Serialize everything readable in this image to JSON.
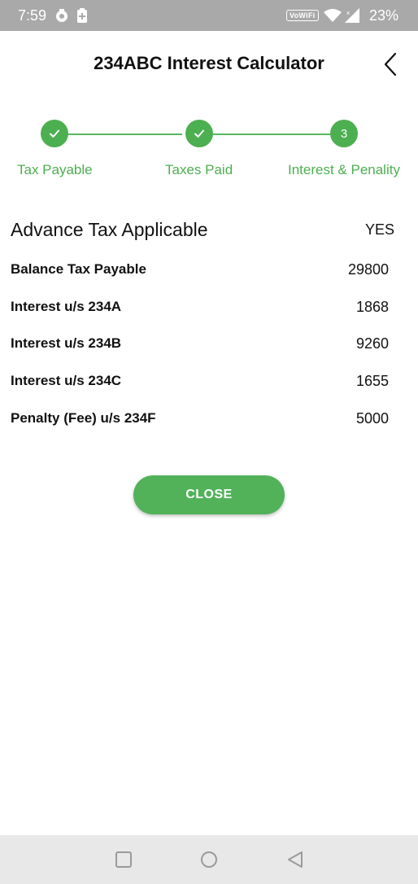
{
  "status_bar": {
    "time": "7:59",
    "vowifi": "VoWiFi",
    "battery": "23%",
    "icons": [
      "settings-icon",
      "battery-saver-icon",
      "wifi-icon",
      "signal-icon"
    ]
  },
  "header": {
    "title": "234ABC Interest Calculator",
    "back_icon": "chevron-left-icon"
  },
  "stepper": {
    "steps": [
      {
        "label": "Tax Payable",
        "state": "done",
        "marker": "check-icon"
      },
      {
        "label": "Taxes Paid",
        "state": "done",
        "marker": "check-icon"
      },
      {
        "label": "Interest & Penality",
        "state": "current",
        "number": "3"
      }
    ],
    "accent_color": "#4caf50"
  },
  "results": {
    "advance_tax": {
      "label": "Advance Tax Applicable",
      "value": "YES"
    },
    "rows": [
      {
        "label": "Balance Tax Payable",
        "value": "29800"
      },
      {
        "label": "Interest u/s 234A",
        "value": "1868"
      },
      {
        "label": "Interest u/s 234B",
        "value": "9260"
      },
      {
        "label": "Interest u/s 234C",
        "value": "1655"
      },
      {
        "label": "Penalty (Fee) u/s 234F",
        "value": "5000"
      }
    ]
  },
  "close_button": {
    "label": "CLOSE",
    "color": "#52b25a"
  },
  "nav_bar": {
    "buttons": [
      "recents-square-icon",
      "home-circle-icon",
      "back-triangle-icon"
    ]
  }
}
